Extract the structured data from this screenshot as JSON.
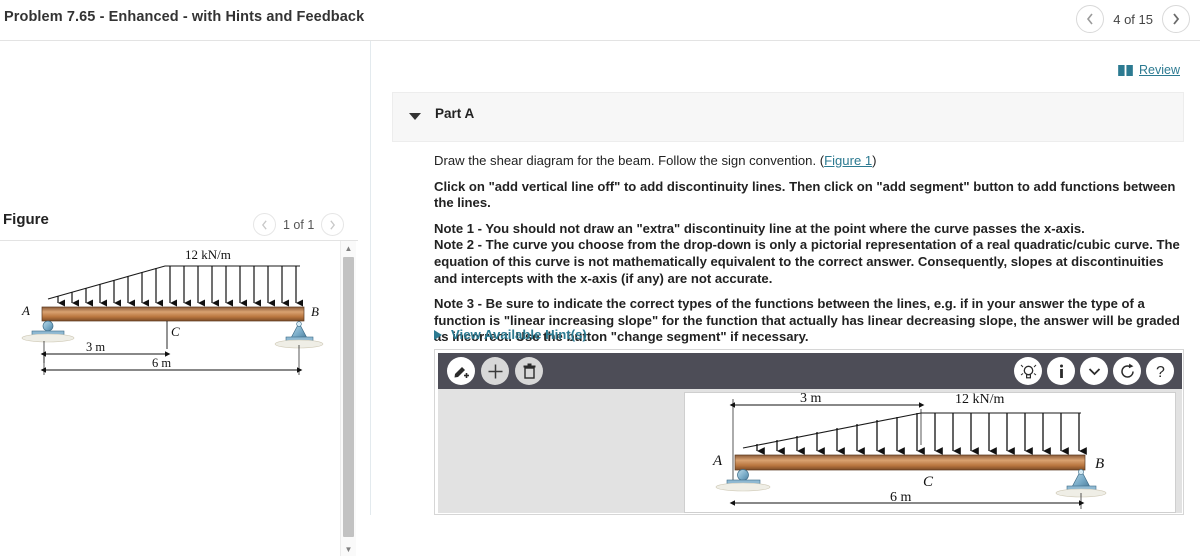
{
  "header": {
    "title": "Problem 7.65 - Enhanced - with Hints and Feedback",
    "prev_icon": "chevron-left-icon",
    "next_icon": "chevron-right-icon",
    "pager_label": "4 of 15"
  },
  "review": {
    "icon": "book-icon",
    "label": "Review",
    "color": "#2c7a91"
  },
  "figure_panel": {
    "title": "Figure",
    "pager_label": "1 of 1",
    "prev_icon": "chevron-left-icon",
    "next_icon": "chevron-right-icon",
    "scroll_up_icon": "scroll-up-arrow-icon",
    "scroll_down_icon": "scroll-down-arrow-icon",
    "diagram": {
      "load_label": "12 kN/m",
      "support_a": "A",
      "support_b": "B",
      "point_c": "C",
      "dim_1": "3 m",
      "dim_2": "6 m",
      "beam_color": "#b5764a",
      "support_color": "#7fb2cc"
    }
  },
  "part": {
    "collapse_icon": "triangle-down-icon",
    "label": "Part A"
  },
  "prose": {
    "line1_a": "Draw the shear diagram for the beam. Follow the sign convention. (",
    "line1_link": "Figure 1",
    "line1_b": ")",
    "para2": "Click on \"add vertical line off\" to add discontinuity lines. Then click on \"add segment\" button to add functions between the lines.",
    "note1": "Note 1 - You should not draw an \"extra\" discontinuity line at the point where the curve passes the x-axis.",
    "note2": "Note 2 - The curve you choose from the drop-down is only a pictorial representation of a real quadratic/cubic curve. The equation of this curve is not mathematically equivalent to the correct answer. Consequently, slopes at discontinuities and intercepts with the x-axis (if any) are not accurate.",
    "note3": "Note 3 - Be sure to indicate the correct types of the functions between the lines, e.g. if in your answer the type of a function is \"linear increasing slope\" for the function that actually has linear decreasing slope, the answer will be graded as incorrect. Use the button \"change segment\" if necessary."
  },
  "hints": {
    "icon": "triangle-right-icon",
    "label": "View Available Hint(s)"
  },
  "toolbar": {
    "background": "#4d4d57",
    "left_buttons": [
      {
        "name": "add-segment-button",
        "icon": "pencil-plus-icon"
      },
      {
        "name": "add-vertical-line-button",
        "icon": "plus-icon"
      },
      {
        "name": "delete-button",
        "icon": "trash-icon"
      }
    ],
    "right_buttons": [
      {
        "name": "hint-button",
        "icon": "lightbulb-icon"
      },
      {
        "name": "info-button",
        "icon": "info-icon"
      },
      {
        "name": "dropdown-button",
        "icon": "chevron-down-icon"
      },
      {
        "name": "reset-button",
        "icon": "refresh-icon"
      },
      {
        "name": "help-button",
        "icon": "question-mark-icon"
      }
    ]
  },
  "answer_canvas": {
    "diagram": {
      "load_label": "12 kN/m",
      "support_a": "A",
      "support_b": "B",
      "point_c": "C",
      "dim_1": "3 m",
      "dim_2": "6 m"
    }
  }
}
